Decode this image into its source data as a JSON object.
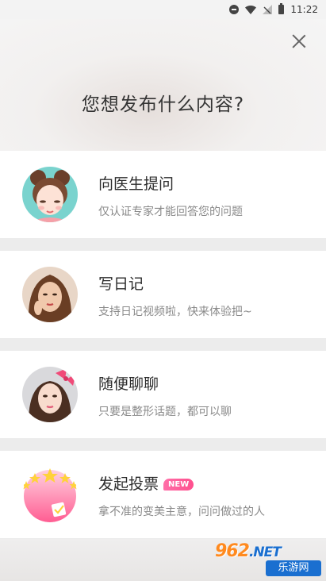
{
  "status_bar": {
    "time": "11:22"
  },
  "header": {
    "title": "您想发布什么内容?"
  },
  "options": [
    {
      "title": "向医生提问",
      "subtitle": "仅认证专家才能回答您的问题"
    },
    {
      "title": "写日记",
      "subtitle": "支持日记视频啦，快来体验把~"
    },
    {
      "title": "随便聊聊",
      "subtitle": "只要是整形话题，都可以聊"
    },
    {
      "title": "发起投票",
      "badge": "NEW",
      "subtitle": "拿不准的变美主意，问问做过的人"
    }
  ],
  "watermark": {
    "brand": "962",
    "domain": ".NET",
    "site": "乐游网"
  },
  "colors": {
    "badge": "#ff4f8e",
    "card": "#ffffff",
    "background": "#ececec"
  }
}
